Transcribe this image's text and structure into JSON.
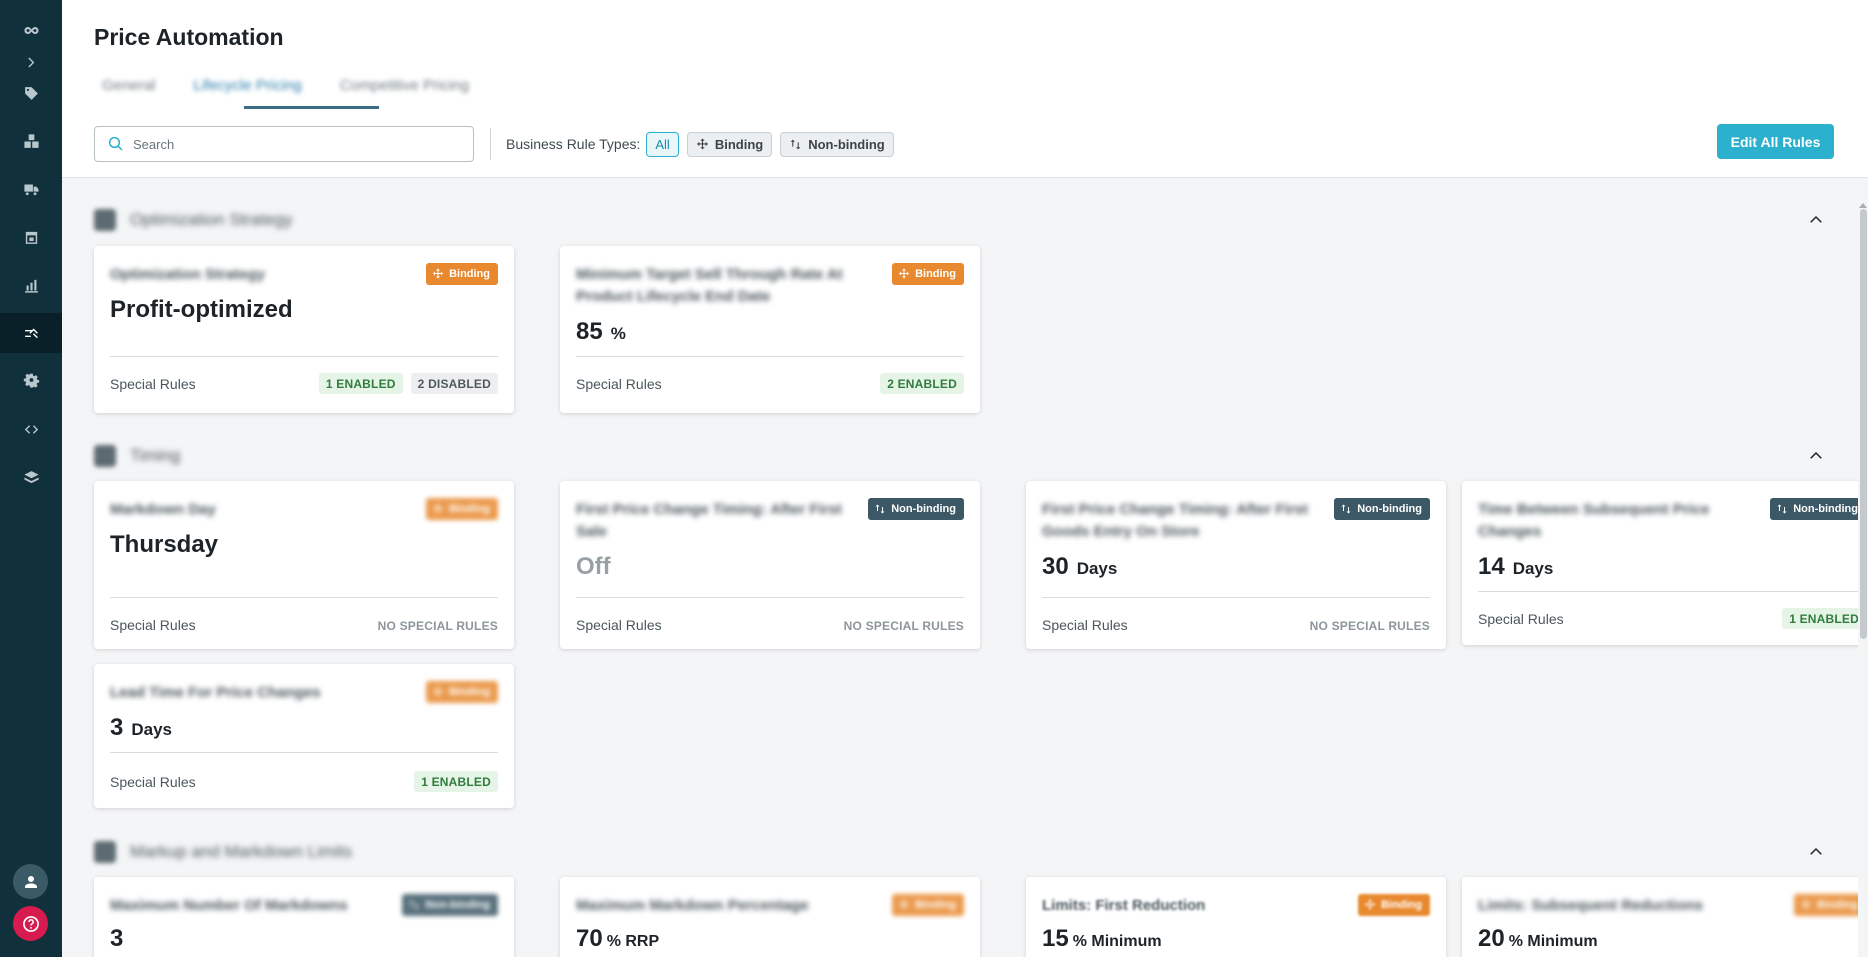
{
  "app": {
    "page_title": "Price Automation",
    "tabs": [
      {
        "label": "General",
        "active": false
      },
      {
        "label": "Lifecycle Pricing",
        "active": true
      },
      {
        "label": "Competitive Pricing",
        "active": false
      }
    ]
  },
  "toolbar": {
    "search_placeholder": "Search",
    "rule_types_label": "Business Rule Types:",
    "filters": [
      {
        "label": "All",
        "selected": true
      },
      {
        "label": "Binding",
        "icon": "move-arrows-icon",
        "selected": false
      },
      {
        "label": "Non-binding",
        "icon": "swap-arrows-icon",
        "selected": false
      }
    ],
    "edit_all_label": "Edit All Rules"
  },
  "colors": {
    "sidebar": "#10303c",
    "accent": "#2bb0cd",
    "binding_badge": "#e8892f",
    "nonbinding_badge": "#3c5866",
    "enabled_pill_bg": "#e6f4e8",
    "enabled_pill_text": "#2e7d3a",
    "help_button": "#d81b4e"
  },
  "sidebar": {
    "items": [
      {
        "icon": "logo-icon"
      },
      {
        "icon": "chevron-right-icon"
      },
      {
        "icon": "tag-icon"
      },
      {
        "icon": "boxes-icon"
      },
      {
        "icon": "truck-icon"
      },
      {
        "icon": "calendar-icon"
      },
      {
        "icon": "bar-chart-icon"
      },
      {
        "icon": "price-automation-icon",
        "active": true
      },
      {
        "icon": "gear-icon"
      },
      {
        "icon": "code-icon"
      },
      {
        "icon": "stack-icon"
      }
    ],
    "bottom": [
      {
        "icon": "user-icon"
      },
      {
        "icon": "help-icon"
      }
    ]
  },
  "sections": [
    {
      "title": "Optimization Strategy",
      "cards": [
        {
          "title": "Optimization Strategy",
          "badge": "Binding",
          "badge_type": "binding",
          "value": "Profit-optimized",
          "unit": "",
          "special_rules_label": "Special Rules",
          "pills": [
            {
              "label": "1 ENABLED",
              "type": "enabled"
            },
            {
              "label": "2 DISABLED",
              "type": "disabled"
            }
          ]
        },
        {
          "title": "Minimum Target Sell Through Rate At Product Lifecycle End Date",
          "badge": "Binding",
          "badge_type": "binding",
          "value": "85",
          "unit": "%",
          "special_rules_label": "Special Rules",
          "pills": [
            {
              "label": "2 ENABLED",
              "type": "enabled"
            }
          ]
        }
      ]
    },
    {
      "title": "Timing",
      "cards": [
        {
          "title": "Markdown Day",
          "badge": "Binding",
          "badge_type": "binding",
          "value": "Thursday",
          "unit": "",
          "special_rules_label": "Special Rules",
          "no_rules": "NO SPECIAL RULES"
        },
        {
          "title": "First Price Change Timing: After First Sale",
          "badge": "Non-binding",
          "badge_type": "nonbinding",
          "value": "Off",
          "unit": "",
          "special_rules_label": "Special Rules",
          "no_rules": "NO SPECIAL RULES"
        },
        {
          "title": "First Price Change Timing: After First Goods Entry On Store",
          "badge": "Non-binding",
          "badge_type": "nonbinding",
          "value": "30",
          "unit": "Days",
          "special_rules_label": "Special Rules",
          "no_rules": "NO SPECIAL RULES"
        },
        {
          "title": "Time Between Subsequent Price Changes",
          "badge": "Non-binding",
          "badge_type": "nonbinding",
          "value": "14",
          "unit": "Days",
          "special_rules_label": "Special Rules",
          "pills": [
            {
              "label": "1 ENABLED",
              "type": "enabled"
            }
          ]
        },
        {
          "title": "Lead Time For Price Changes",
          "badge": "Binding",
          "badge_type": "binding",
          "value": "3",
          "unit": "Days",
          "special_rules_label": "Special Rules",
          "pills": [
            {
              "label": "1 ENABLED",
              "type": "enabled"
            }
          ]
        }
      ]
    },
    {
      "title": "Markup and Markdown Limits",
      "cards": [
        {
          "title": "Maximum Number Of Markdowns",
          "badge": "Non-binding",
          "badge_type": "nonbinding",
          "value": "3",
          "unit": ""
        },
        {
          "title": "Maximum Markdown Percentage",
          "badge": "Binding",
          "badge_type": "binding",
          "value": "70",
          "unit": "% RRP"
        },
        {
          "title": "Limits: First Reduction",
          "badge": "Binding",
          "badge_type": "binding",
          "value": "15",
          "unit": "% Minimum"
        },
        {
          "title": "Limits: Subsequent Reductions",
          "badge": "Binding",
          "badge_type": "binding",
          "value": "20",
          "unit": "% Minimum"
        }
      ]
    }
  ]
}
